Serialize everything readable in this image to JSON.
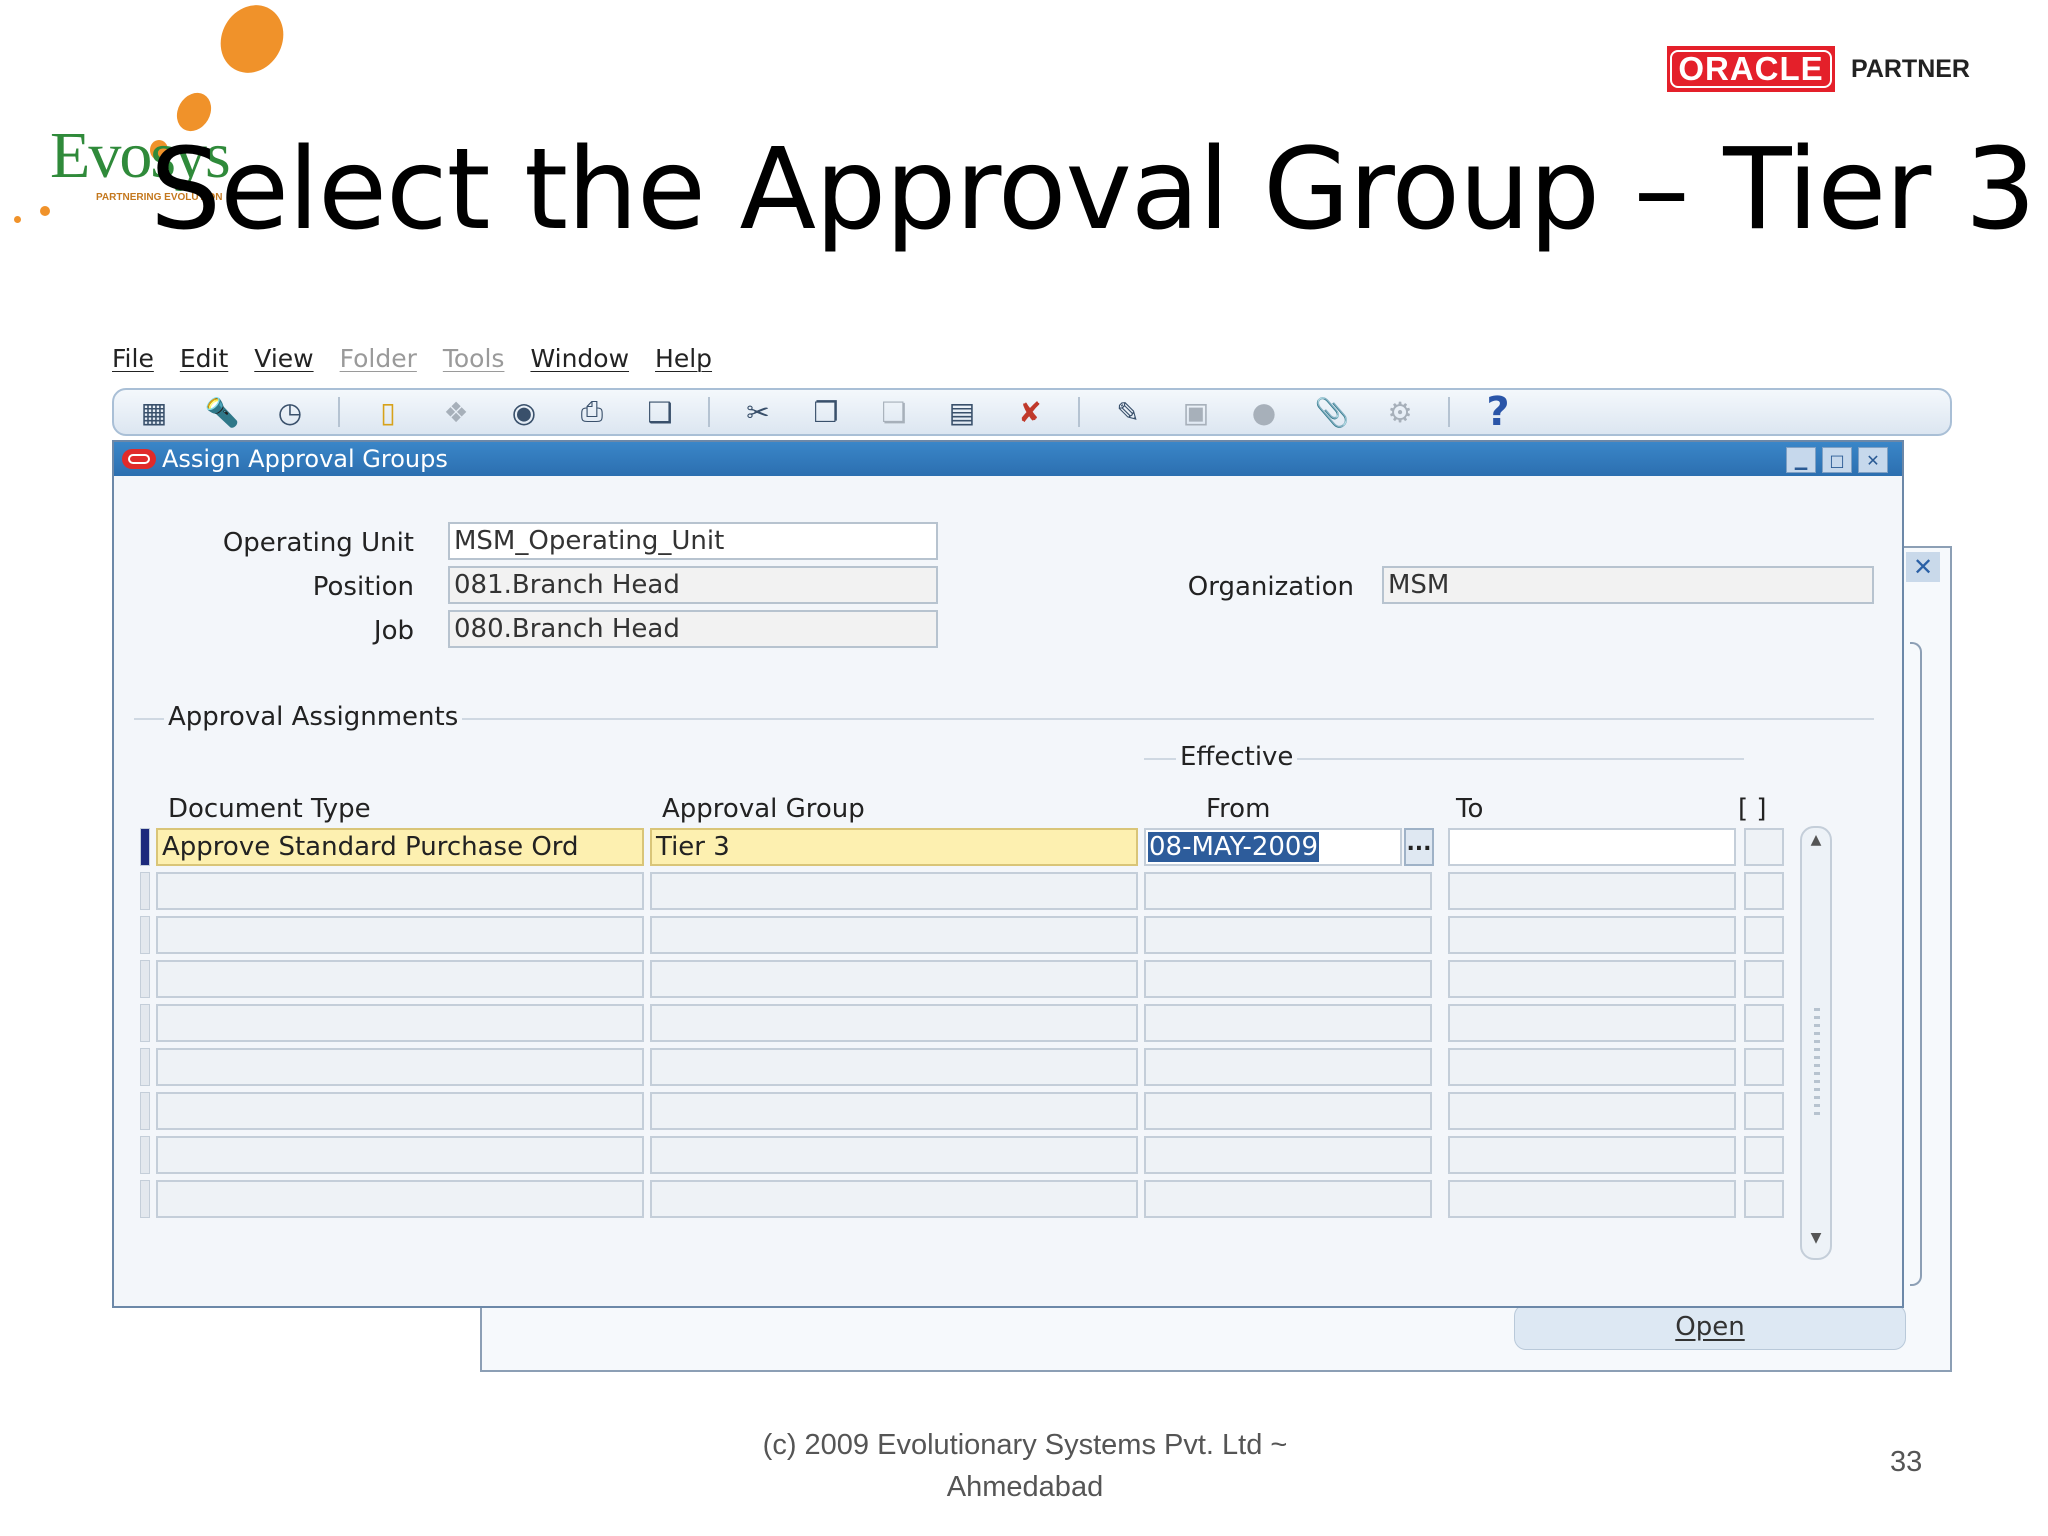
{
  "slide": {
    "title": "Select the Approval Group – Tier 3",
    "footer_line1": "(c) 2009 Evolutionary Systems Pvt. Ltd ~",
    "footer_line2": "Ahmedabad",
    "page_number": "33",
    "logo_left_text": "Evosys",
    "logo_left_tagline": "PARTNERING EVOLUTION",
    "logo_right_brand": "ORACLE",
    "logo_right_partner": "PARTNER"
  },
  "menubar": {
    "items": [
      {
        "label": "File",
        "enabled": true
      },
      {
        "label": "Edit",
        "enabled": true
      },
      {
        "label": "View",
        "enabled": true
      },
      {
        "label": "Folder",
        "enabled": false
      },
      {
        "label": "Tools",
        "enabled": false
      },
      {
        "label": "Window",
        "enabled": true
      },
      {
        "label": "Help",
        "enabled": true
      }
    ]
  },
  "toolbar": {
    "icons": [
      "new-record-icon",
      "find-icon",
      "navigator-icon",
      "save-icon",
      "next-step-icon",
      "switch-responsibility-icon",
      "print-icon",
      "close-form-icon",
      "cut-icon",
      "copy-icon",
      "paste-icon",
      "clear-record-icon",
      "delete-record-icon",
      "edit-field-icon",
      "zoom-icon",
      "translations-icon",
      "attachments-icon",
      "folder-tools-icon",
      "help-icon"
    ]
  },
  "window": {
    "title": "Assign Approval Groups",
    "operating_unit_label": "Operating Unit",
    "operating_unit_value": "MSM_Operating_Unit",
    "position_label": "Position",
    "position_value": "081.Branch Head",
    "job_label": "Job",
    "job_value": "080.Branch Head",
    "organization_label": "Organization",
    "organization_value": "MSM",
    "section_label": "Approval Assignments",
    "effective_label": "Effective",
    "columns": {
      "document_type": "Document Type",
      "approval_group": "Approval Group",
      "from": "From",
      "to": "To",
      "flex": "[ ]"
    },
    "rows": [
      {
        "document_type": "Approve Standard Purchase Ord",
        "approval_group": "Tier 3",
        "from": "08-MAY-2009",
        "to": ""
      }
    ],
    "lov_label": "..."
  },
  "background_window": {
    "open_button": "Open"
  }
}
